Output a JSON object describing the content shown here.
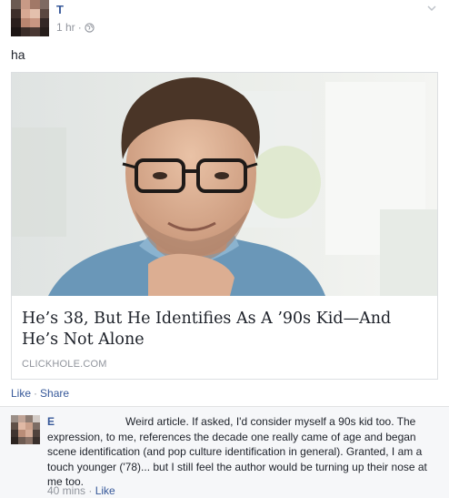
{
  "post": {
    "author": "T",
    "timestamp": "1 hr",
    "separator": "·",
    "text": "ha",
    "privacy_icon": "globe-icon",
    "menu_icon": "chevron-down-icon"
  },
  "link": {
    "title": "He’s 38, But He Identifies As A ’90s Kid—And He’s Not Alone",
    "domain": "CLICKHOLE.COM"
  },
  "actions": {
    "like": "Like",
    "separator": "·",
    "share": "Share"
  },
  "comment": {
    "author": "E",
    "text": "Weird article. If asked, I'd consider myself a 90s kid too. The expression, to me, references the decade one really came of age and began scene identification (and pop culture identification in general). Granted, I am a touch younger ('78)... but I still feel the author would be turning up their nose at me too.",
    "time": "40 mins",
    "separator": "·",
    "like": "Like"
  },
  "colors": {
    "link_blue": "#365899",
    "meta_gray": "#90949c",
    "text": "#1d2129",
    "comment_bg": "#f6f7f9"
  }
}
